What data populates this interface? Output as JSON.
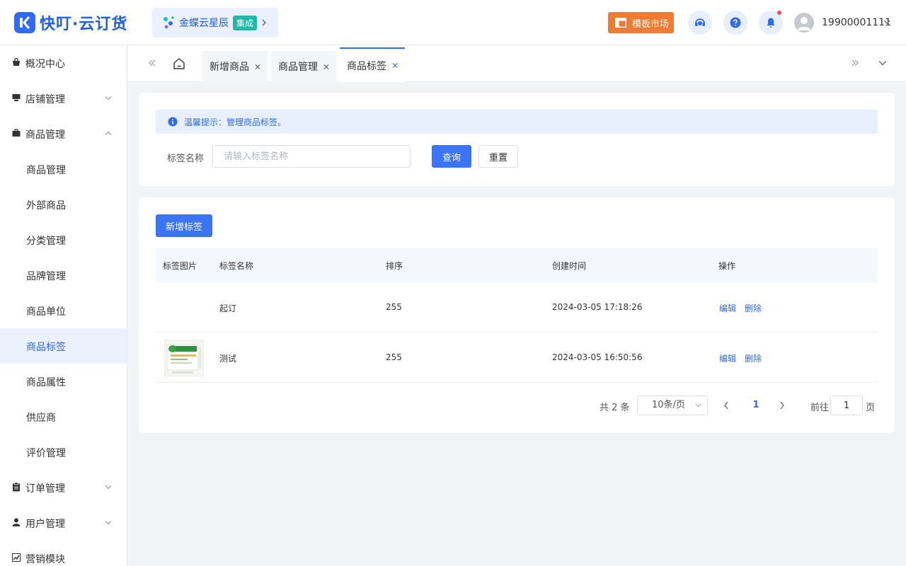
{
  "header": {
    "logo_text": "快叮·云订货",
    "integration_label": "金蝶云星辰",
    "integration_badge": "集成",
    "template_market_label": "模板市场",
    "username": "19900001111"
  },
  "sidebar": {
    "items": [
      {
        "label": "概况中心",
        "icon": "shop-bag-icon"
      },
      {
        "label": "店铺管理",
        "icon": "store-icon"
      },
      {
        "label": "商品管理",
        "icon": "briefcase-icon"
      },
      {
        "label": "订单管理",
        "icon": "clipboard-icon"
      },
      {
        "label": "用户管理",
        "icon": "user-icon"
      },
      {
        "label": "营销模块",
        "icon": "trend-icon"
      }
    ],
    "sub_items": [
      "商品管理",
      "外部商品",
      "分类管理",
      "品牌管理",
      "商品单位",
      "商品标签",
      "商品属性",
      "供应商",
      "评价管理"
    ],
    "active_sub": "商品标签"
  },
  "tabs": [
    {
      "label": "新增商品"
    },
    {
      "label": "商品管理"
    },
    {
      "label": "商品标签"
    }
  ],
  "search_panel": {
    "alert_text": "温馨提示：管理商品标签。",
    "field_label": "标签名称",
    "field_placeholder": "请输入标签名称",
    "field_value": "",
    "query_button": "查询",
    "reset_button": "重置"
  },
  "list_panel": {
    "add_button": "新增标签",
    "columns": [
      "标签图片",
      "标签名称",
      "排序",
      "创建时间",
      "操作"
    ],
    "rows": [
      {
        "image": "",
        "name": "起订",
        "sort": "255",
        "created": "2024-03-05 17:18:26",
        "edit": "编辑",
        "delete": "删除"
      },
      {
        "image": "product-thumbnail",
        "name": "测试",
        "sort": "255",
        "created": "2024-03-05 16:50:56",
        "edit": "编辑",
        "delete": "删除"
      }
    ]
  },
  "pagination": {
    "total_text": "共 2 条",
    "page_size": "10条/页",
    "current_page": "1",
    "goto_label": "前往",
    "goto_value": "1",
    "page_suffix": "页"
  },
  "colors": {
    "primary": "#2e6bf6",
    "template_button": "#f07b33",
    "badge": "#21b8a7",
    "active_bg": "#ebf1fd"
  }
}
